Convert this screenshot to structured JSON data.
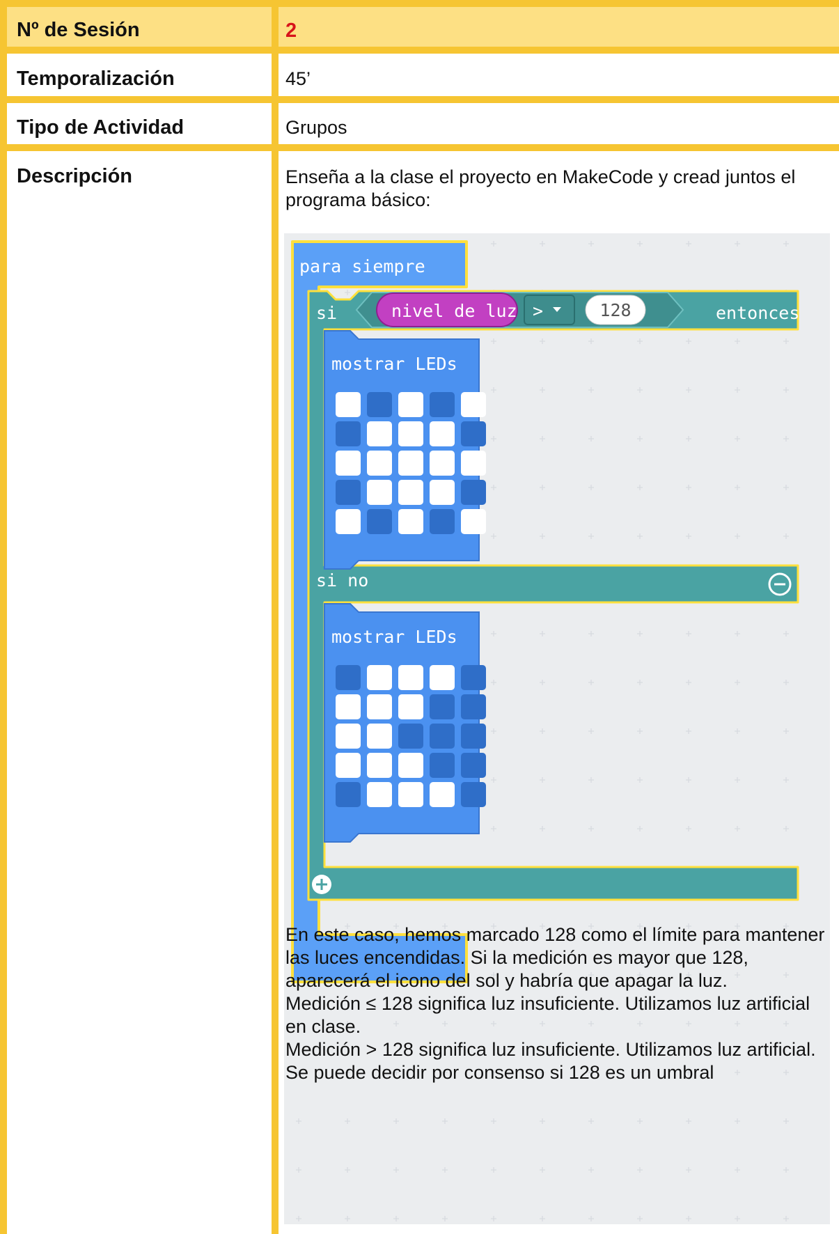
{
  "rows": [
    {
      "label": "Nº de Sesión",
      "value": "2"
    },
    {
      "label": "Temporalización",
      "value": "45’"
    },
    {
      "label": "Tipo de Actividad",
      "value": "Grupos"
    },
    {
      "label": "Descripción",
      "value": "Enseña a la clase el proyecto en MakeCode y cread juntos el programa básico:"
    }
  ],
  "makecode": {
    "forever_label": "para siempre",
    "if_label": "si",
    "sensor_label": "nivel de luz",
    "operator": ">",
    "threshold": "128",
    "then_label": "entonces",
    "else_label": "si no",
    "show_leds_label": "mostrar LEDs",
    "leds_then": [
      [
        1,
        0,
        1,
        0,
        1
      ],
      [
        0,
        1,
        1,
        1,
        0
      ],
      [
        1,
        1,
        1,
        1,
        1
      ],
      [
        0,
        1,
        1,
        1,
        0
      ],
      [
        1,
        0,
        1,
        0,
        1
      ]
    ],
    "leds_else": [
      [
        0,
        1,
        1,
        1,
        0
      ],
      [
        1,
        1,
        1,
        0,
        0
      ],
      [
        1,
        1,
        0,
        0,
        0
      ],
      [
        1,
        1,
        1,
        0,
        0
      ],
      [
        0,
        1,
        1,
        1,
        0
      ]
    ],
    "icons": [
      "dropdown-icon",
      "minus-circle-icon",
      "plus-circle-icon"
    ]
  },
  "explanation": [
    "En este caso, hemos marcado 128 como el límite para mantener las luces encendidas. Si la medición es mayor que 128, aparecerá el icono del sol y habría que apagar la luz.",
    "Medición ≤ 128 significa luz insuficiente. Utilizamos luz artificial en clase.",
    "Medición > 128 significa luz insuficiente. Utilizamos luz artificial.",
    "Se puede decidir por consenso si 128 es un umbral"
  ],
  "colors": {
    "header_fill": "#fde084",
    "border": "#f6c532",
    "session_value": "#d7141a",
    "forever_block": "#5ba0f7",
    "if_block": "#4aa3a3",
    "sensor_block": "#c240c2",
    "led_on": "#ffffff",
    "led_off": "#2f6ec8"
  }
}
